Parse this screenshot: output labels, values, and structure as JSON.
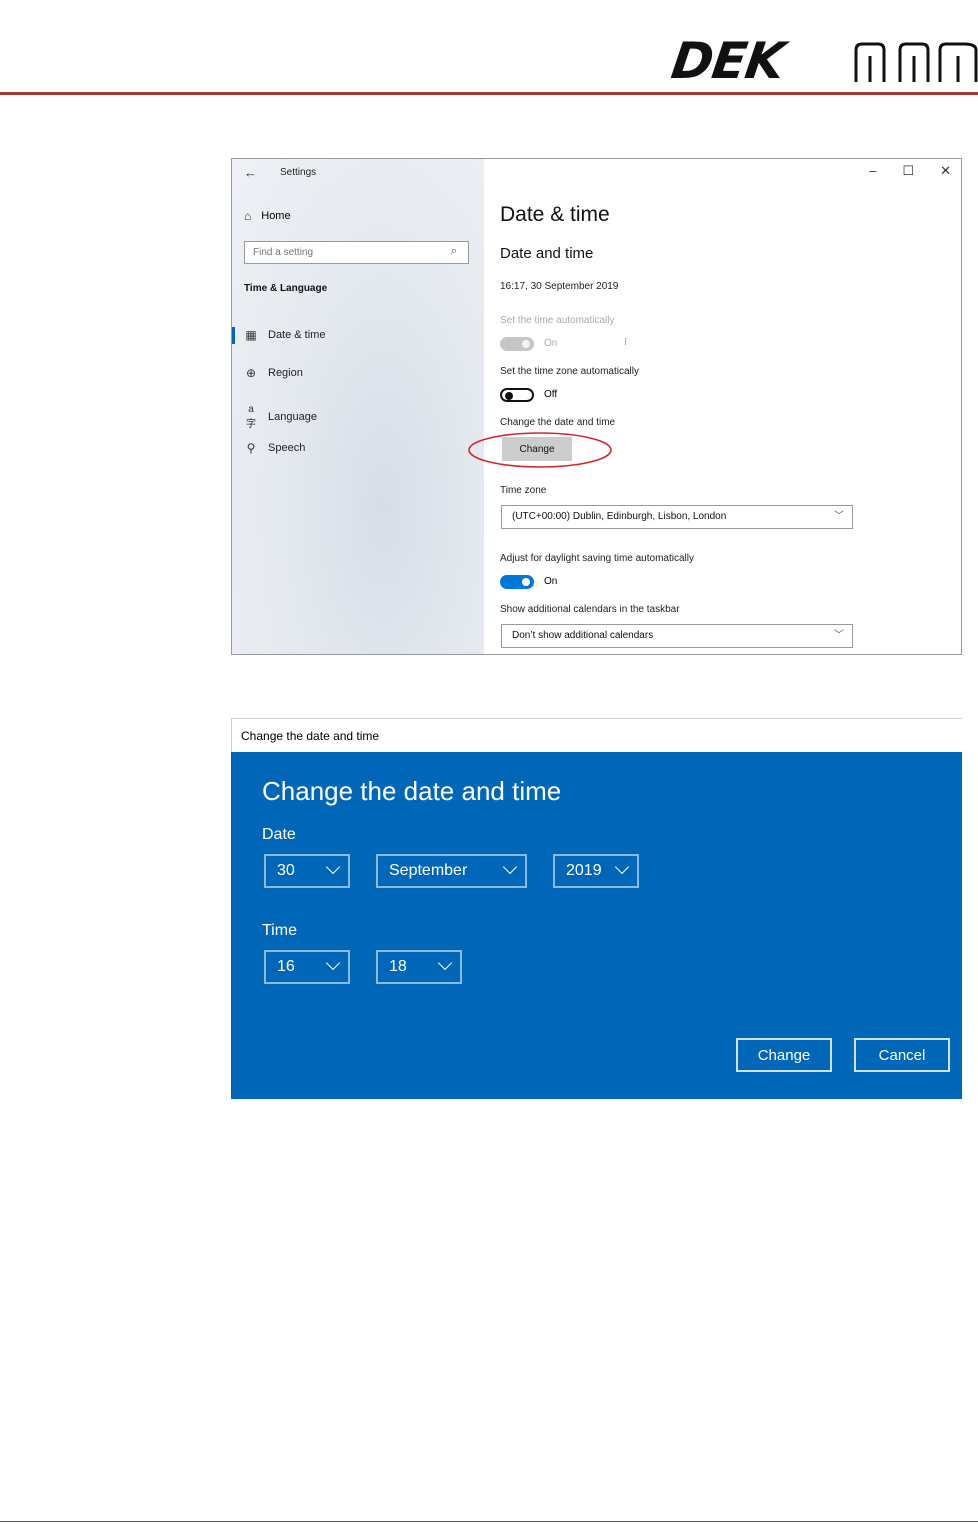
{
  "header": {
    "brand_text": "DEK"
  },
  "settings_window": {
    "app_title": "Settings",
    "window_controls": {
      "minimize": "–",
      "maximize": "☐",
      "close": "✕"
    },
    "sidebar": {
      "home_label": "Home",
      "search_placeholder": "Find a setting",
      "section_title": "Time & Language",
      "items": [
        {
          "label": "Date & time",
          "icon": "calendar-clock-icon",
          "active": true
        },
        {
          "label": "Region",
          "icon": "globe-icon",
          "active": false
        },
        {
          "label": "Language",
          "icon": "language-icon",
          "active": false
        },
        {
          "label": "Speech",
          "icon": "microphone-icon",
          "active": false
        }
      ]
    },
    "main": {
      "page_title": "Date & time",
      "section_title": "Date and time",
      "current_datetime": "16:17, 30 September 2019",
      "set_time_auto": {
        "label": "Set the time automatically",
        "state": "On",
        "enabled": false
      },
      "set_timezone_auto": {
        "label": "Set the time zone automatically",
        "state": "Off"
      },
      "change_datetime": {
        "label": "Change the date and time",
        "button": "Change"
      },
      "time_zone": {
        "label": "Time zone",
        "value": "(UTC+00:00) Dublin, Edinburgh, Lisbon, London"
      },
      "daylight_saving": {
        "label": "Adjust for daylight saving time automatically",
        "state": "On"
      },
      "additional_calendars": {
        "label": "Show additional calendars in the taskbar",
        "value": "Don’t show additional calendars"
      }
    }
  },
  "dialog": {
    "window_title": "Change the date and time",
    "heading": "Change the date and time",
    "date_label": "Date",
    "day": "30",
    "month": "September",
    "year": "2019",
    "time_label": "Time",
    "hour": "16",
    "minute": "18",
    "change_button": "Change",
    "cancel_button": "Cancel",
    "accent_color": "#0067b8"
  },
  "colors": {
    "rule": "#a33a32",
    "highlight": "#d0262d",
    "toggle_on": "#0078d7"
  }
}
